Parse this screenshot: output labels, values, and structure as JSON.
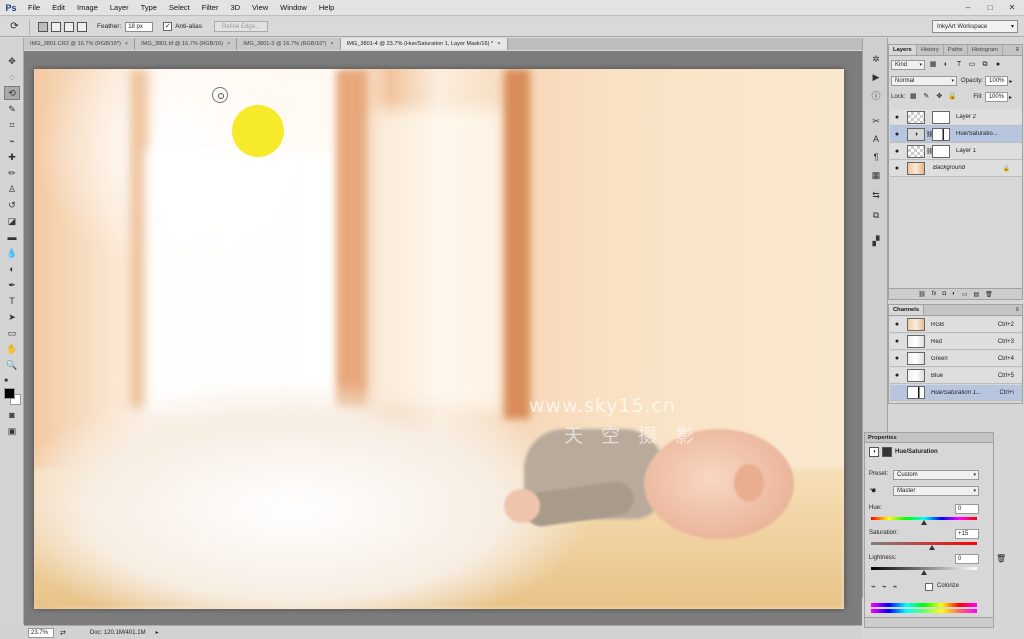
{
  "app": {
    "logo": "Ps",
    "menu": [
      "File",
      "Edit",
      "Image",
      "Layer",
      "Type",
      "Select",
      "Filter",
      "3D",
      "View",
      "Window",
      "Help"
    ],
    "window_controls": [
      "–",
      "□",
      "✕"
    ]
  },
  "options_bar": {
    "feather_label": "Feather:",
    "feather_value": "18 px",
    "antialias_label": "Anti-alias",
    "antialias_checked": "✓",
    "refine_edge_label": "Refine Edge...",
    "workspace_value": "InkyArt Workspace"
  },
  "tabs": [
    {
      "label": "IMG_3801.CR2 @ 16.7% (RGB/16*)",
      "close": "×"
    },
    {
      "label": "IMG_3801.tif @ 16.7% (RGB/16)",
      "close": "×"
    },
    {
      "label": "IMG_3801-3 @ 16.7% (RGB/16*)",
      "close": "×"
    },
    {
      "label": "IMG_3801-4 @ 23.7% (Hue/Saturation 1, Layer Mask/16) *",
      "close": "×"
    }
  ],
  "canvas": {
    "watermark_line1": "www.sky15.cn",
    "watermark_line2": "天 空 摄 影"
  },
  "status_bar": {
    "zoom": "23.7%",
    "doc_info": "Doc: 120.1M/401.1M"
  },
  "layers_panel": {
    "tabs": [
      "Layers",
      "History",
      "Paths",
      "Histogram"
    ],
    "kind_label": "Kind",
    "blend_mode": "Normal",
    "opacity_label": "Opacity:",
    "opacity_value": "100%",
    "lock_label": "Lock:",
    "fill_label": "Fill:",
    "fill_value": "100%",
    "layers": [
      {
        "name": "Layer 2",
        "visible": "●"
      },
      {
        "name": "Hue/Saturatio...",
        "visible": "●"
      },
      {
        "name": "Layer 1",
        "visible": "●"
      },
      {
        "name": "Background",
        "visible": "●"
      }
    ],
    "footer_icons": [
      "⛓",
      "fx",
      "◘",
      "◐",
      "▭",
      "▤",
      "🗑"
    ]
  },
  "channels_panel": {
    "title": "Channels",
    "channels": [
      {
        "name": "RGB",
        "shortcut": "Ctrl+2"
      },
      {
        "name": "Red",
        "shortcut": "Ctrl+3"
      },
      {
        "name": "Green",
        "shortcut": "Ctrl+4"
      },
      {
        "name": "Blue",
        "shortcut": "Ctrl+5"
      },
      {
        "name": "Hue/Saturation 1...",
        "shortcut": "Ctrl+\\"
      }
    ]
  },
  "properties_panel": {
    "title": "Properties",
    "adjustment_name": "Hue/Saturation",
    "preset_label": "Preset:",
    "preset_value": "Custom",
    "channel_value": "Master",
    "hue_label": "Hue:",
    "hue_value": "0",
    "hue_level": 0.5,
    "saturation_label": "Saturation:",
    "saturation_value": "+15",
    "saturation_level": 0.575,
    "lightness_label": "Lightness:",
    "lightness_value": "0",
    "lightness_level": 0.5,
    "colorize_label": "Colorize"
  }
}
